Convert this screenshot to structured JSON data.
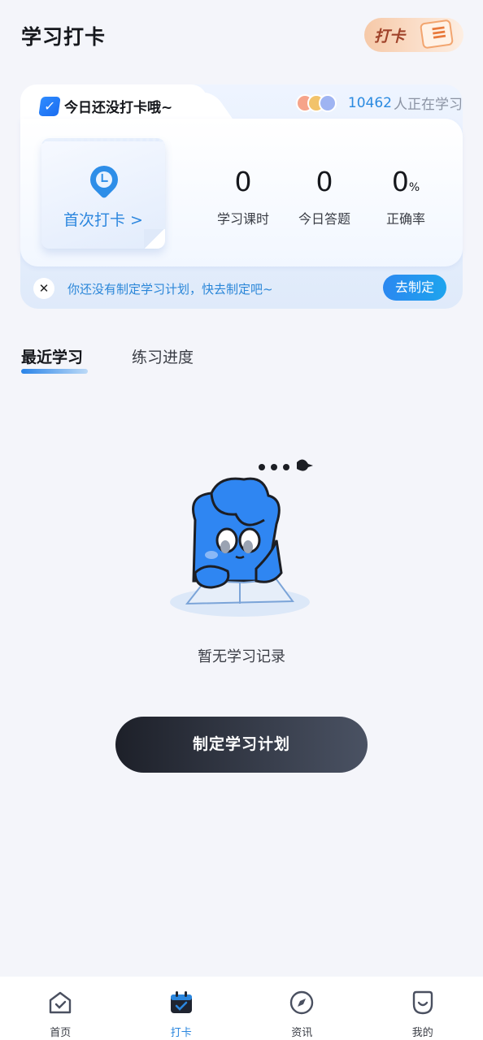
{
  "header": {
    "title": "学习打卡",
    "badge_label": "打卡"
  },
  "card": {
    "status_text": "今日还没打卡哦~",
    "learners_count": "10462",
    "learners_suffix": "人正在学习",
    "checkin_label": "首次打卡 >",
    "stats": [
      {
        "value": "0",
        "unit": "",
        "label": "学习课时"
      },
      {
        "value": "0",
        "unit": "",
        "label": "今日答题"
      },
      {
        "value": "0",
        "unit": "%",
        "label": "正确率"
      }
    ],
    "plan_prompt": "你还没有制定学习计划，快去制定吧~",
    "plan_button": "去制定",
    "close_symbol": "✕"
  },
  "tabs": [
    {
      "label": "最近学习",
      "active": true
    },
    {
      "label": "练习进度",
      "active": false
    }
  ],
  "empty": {
    "message": "暂无学习记录"
  },
  "cta": {
    "label": "制定学习计划"
  },
  "bottom_nav": [
    {
      "label": "首页",
      "icon": "home-icon",
      "active": false
    },
    {
      "label": "打卡",
      "icon": "calendar-check-icon",
      "active": true
    },
    {
      "label": "资讯",
      "icon": "compass-icon",
      "active": false
    },
    {
      "label": "我的",
      "icon": "profile-icon",
      "active": false
    }
  ],
  "colors": {
    "accent": "#2a86de",
    "background": "#f4f5fa",
    "cta_dark": "#1d2029"
  }
}
